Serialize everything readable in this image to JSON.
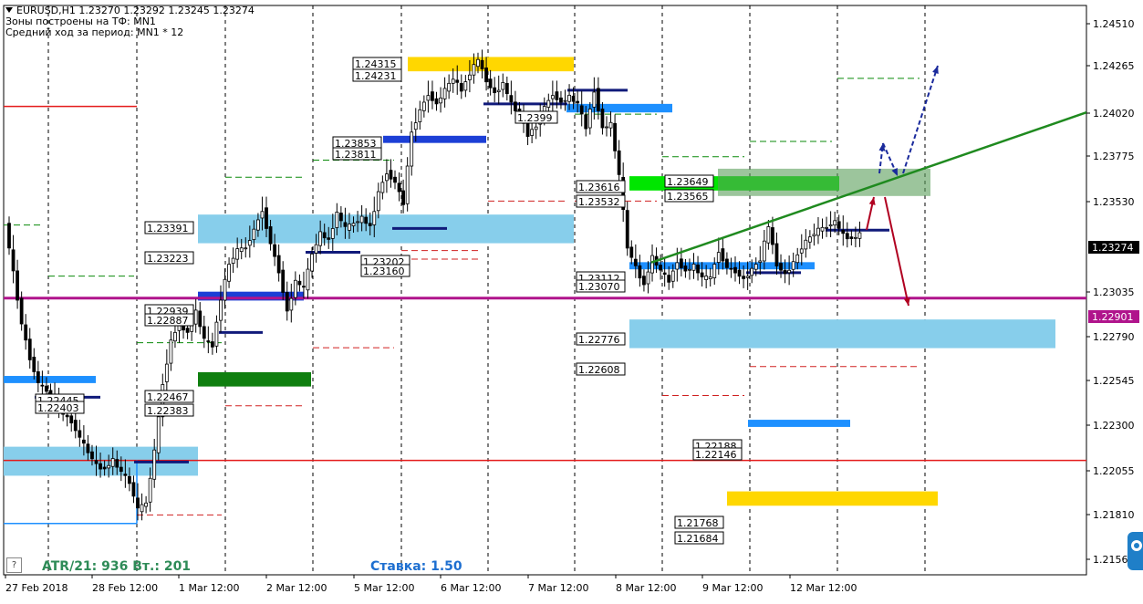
{
  "header": {
    "symbol_line": "EURUSD,H1  1.23270 1.23292 1.23245 1.23274",
    "zones_line": "Зоны построены на ТФ: MN1",
    "atr_period_line": "Средний ход за период: MN1 * 12"
  },
  "footer": {
    "atr_text": "ATR/21: 936",
    "vt_text": "Вт.: 201",
    "rate_text": "Ставка: 1.50",
    "help": "?"
  },
  "colors": {
    "up_arrow": "#b00020",
    "down_arrow": "#b00020",
    "forecast_arrow": "#1a2a9c",
    "trendline": "#1f8a1f",
    "level_magenta": "#b0148c",
    "level_red": "#e41a1a",
    "zone_lightblue": "#87ceeb",
    "zone_yellow": "#ffd700",
    "zone_green": "#00e600",
    "zone_darkgreen": "#0f7f0f",
    "zone_blue": "#1e90ff"
  },
  "chart_data": {
    "type": "candlestick",
    "title": "EURUSD,H1",
    "ylim": [
      1.2152,
      1.2462
    ],
    "y_ticks": [
      "1.24510",
      "1.24265",
      "1.24020",
      "1.23775",
      "1.23530",
      "1.23274",
      "1.23035",
      "1.22901",
      "1.22790",
      "1.22545",
      "1.22300",
      "1.22055",
      "1.21810",
      "1.2156"
    ],
    "x_labels": [
      "27 Feb 2018",
      "28 Feb 12:00",
      "1 Mar 12:00",
      "2 Mar 12:00",
      "5 Mar 12:00",
      "6 Mar 12:00",
      "7 Mar 12:00",
      "8 Mar 12:00",
      "9 Mar 12:00",
      "12 Mar 12:00"
    ],
    "current_price": "1.23274",
    "key_level": "1.22901",
    "price_path": [
      1.2334,
      1.2305,
      1.2275,
      1.2255,
      1.224,
      1.2236,
      1.223,
      1.2222,
      1.2218,
      1.2208,
      1.22,
      1.2192,
      1.219,
      1.2195,
      1.2188,
      1.2182,
      1.2166,
      1.217,
      1.22,
      1.224,
      1.2265,
      1.2275,
      1.227,
      1.2282,
      1.2266,
      1.2262,
      1.229,
      1.231,
      1.2318,
      1.232,
      1.233,
      1.2342,
      1.2322,
      1.2306,
      1.2282,
      1.23,
      1.2296,
      1.2316,
      1.2328,
      1.2324,
      1.234,
      1.2331,
      1.2334,
      1.2337,
      1.2332,
      1.2352,
      1.2364,
      1.2358,
      1.2346,
      1.2388,
      1.24,
      1.241,
      1.2404,
      1.2412,
      1.2419,
      1.2412,
      1.2422,
      1.243,
      1.2418,
      1.241,
      1.2416,
      1.2404,
      1.2398,
      1.2386,
      1.2391,
      1.2402,
      1.241,
      1.2405,
      1.2408,
      1.2404,
      1.239,
      1.2412,
      1.239,
      1.2392,
      1.2362,
      1.232,
      1.2308,
      1.2298,
      1.2314,
      1.2306,
      1.23,
      1.2312,
      1.2306,
      1.2309,
      1.2302,
      1.2302,
      1.2318,
      1.2308,
      1.2306,
      1.2301,
      1.2307,
      1.2313,
      1.2332,
      1.231,
      1.2304,
      1.2311,
      1.232,
      1.2326,
      1.233,
      1.2332,
      1.2335,
      1.2327,
      1.2325,
      1.23274
    ],
    "zones": [
      {
        "top": "1.24315",
        "bottom": "1.24231",
        "color": "zone_yellow"
      },
      {
        "top": "1.23853",
        "bottom": "1.23811",
        "color": "zone_blue"
      },
      {
        "top": "1.23649",
        "bottom": "1.23565",
        "color": "zone_green"
      },
      {
        "top": "1.23616",
        "bottom": "1.23532",
        "color": "zone_green"
      },
      {
        "top": "1.23391",
        "bottom": "1.23223",
        "color": "zone_lightblue"
      },
      {
        "top": "1.23160",
        "bottom": "1.23160",
        "color": "zone_blue"
      },
      {
        "top": "1.23112",
        "bottom": "1.23070",
        "color": "zone_blue"
      },
      {
        "top": "1.22939",
        "bottom": "1.22887",
        "color": "zone_blue"
      },
      {
        "top": "1.22776",
        "bottom": "1.22608",
        "color": "zone_lightblue"
      },
      {
        "top": "1.22467",
        "bottom": "1.22383",
        "color": "zone_darkgreen"
      },
      {
        "top": "1.22445",
        "bottom": "1.22403",
        "color": "zone_blue"
      },
      {
        "top": "1.22188",
        "bottom": "1.22146",
        "color": "zone_blue"
      },
      {
        "top": "1.21768",
        "bottom": "1.21684",
        "color": "zone_yellow"
      },
      {
        "top": "1.2399",
        "bottom": "1.2399",
        "color": "zone_blue"
      }
    ],
    "level_labels": [
      "1.24315",
      "1.24231",
      "1.23853",
      "1.23811",
      "1.23649",
      "1.23565",
      "1.23616",
      "1.23532",
      "1.23391",
      "1.23223",
      "1.23160",
      "1.23112",
      "1.23070",
      "1.22939",
      "1.22887",
      "1.22776",
      "1.22608",
      "1.22467",
      "1.22383",
      "1.22445",
      "1.22403",
      "1.22188",
      "1.22146",
      "1.21768",
      "1.21684",
      "1.2399",
      "1.23202"
    ]
  }
}
